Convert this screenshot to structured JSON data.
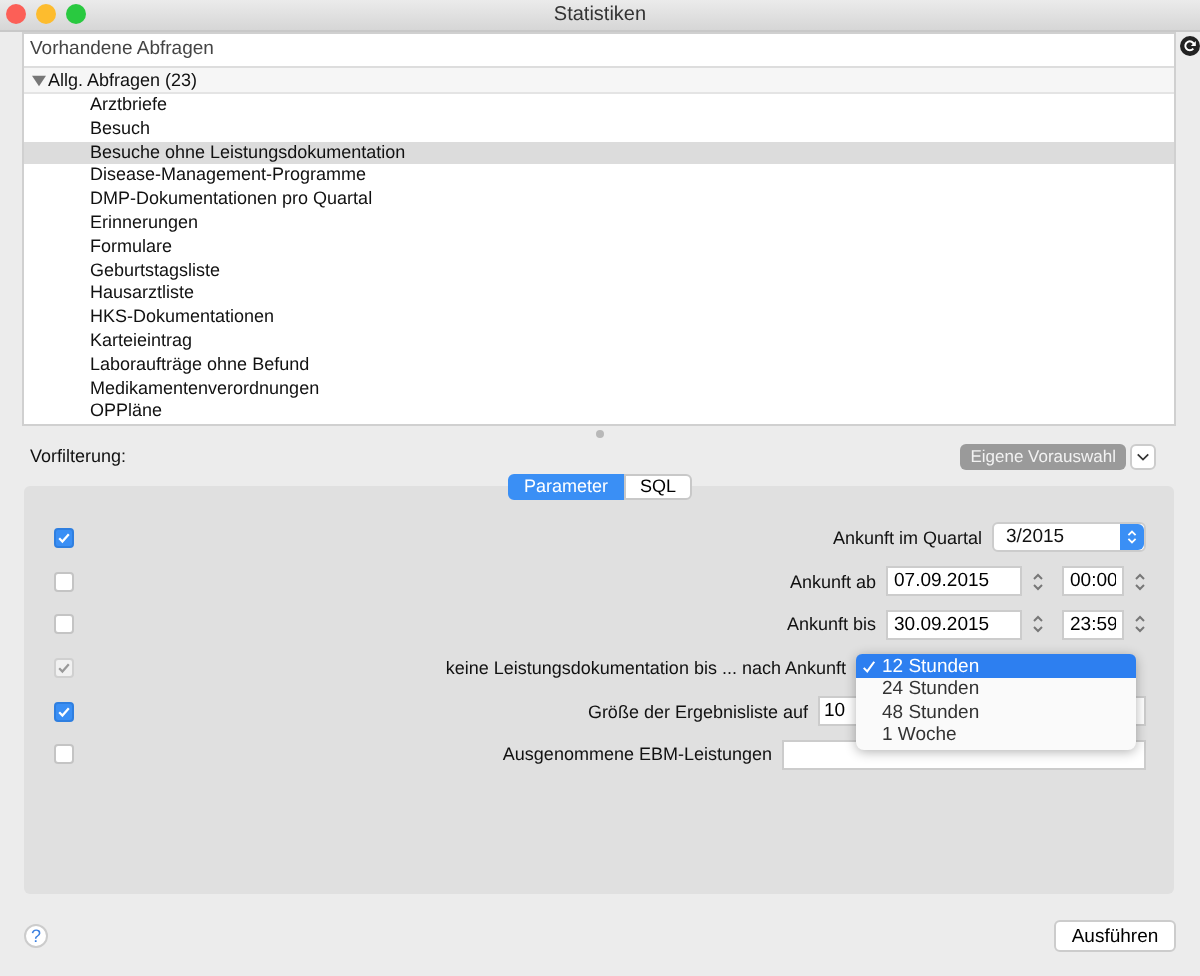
{
  "window": {
    "title": "Statistiken"
  },
  "query_list": {
    "header": "Vorhandene Abfragen",
    "groups": [
      {
        "label": "Allg. Abfragen (23)",
        "expanded": true,
        "children": [
          {
            "label": "Arztbriefe",
            "selected": false
          },
          {
            "label": "Besuch",
            "selected": false
          },
          {
            "label": "Besuche ohne Leistungsdokumentation",
            "selected": true
          },
          {
            "label": "Disease-Management-Programme",
            "selected": false
          },
          {
            "label": "DMP-Dokumentationen pro Quartal",
            "selected": false
          },
          {
            "label": "Erinnerungen",
            "selected": false
          },
          {
            "label": "Formulare",
            "selected": false
          },
          {
            "label": "Geburtstagsliste",
            "selected": false
          },
          {
            "label": "Hausarztliste",
            "selected": false
          },
          {
            "label": "HKS-Dokumentationen",
            "selected": false
          },
          {
            "label": "Karteieintrag",
            "selected": false
          },
          {
            "label": "Laboraufträge ohne Befund",
            "selected": false
          },
          {
            "label": "Medikamentenverordnungen",
            "selected": false
          },
          {
            "label": "OPPläne",
            "selected": false
          }
        ]
      }
    ]
  },
  "prefilter": {
    "label": "Vorfilterung:",
    "preset_button": "Eigene Vorauswahl"
  },
  "tabs": [
    {
      "label": "Parameter",
      "selected": true
    },
    {
      "label": "SQL",
      "selected": false
    }
  ],
  "parameters": [
    {
      "kind": "select",
      "checked": true,
      "disabled": false,
      "label": "Ankunft im Quartal",
      "value": "3/2015"
    },
    {
      "kind": "datetime",
      "checked": false,
      "disabled": false,
      "label": "Ankunft ab",
      "date": "07.09.2015",
      "time": "00:00"
    },
    {
      "kind": "datetime",
      "checked": false,
      "disabled": false,
      "label": "Ankunft bis",
      "date": "30.09.2015",
      "time": "23:59"
    },
    {
      "kind": "menu",
      "checked": true,
      "disabled": true,
      "label": "keine Leistungsdokumentation bis ... nach Ankunft",
      "open": true,
      "options": [
        {
          "label": "12 Stunden",
          "selected": true
        },
        {
          "label": "24 Stunden",
          "selected": false
        },
        {
          "label": "48 Stunden",
          "selected": false
        },
        {
          "label": "1 Woche",
          "selected": false
        }
      ]
    },
    {
      "kind": "number",
      "checked": true,
      "disabled": false,
      "label": "Größe der Ergebnisliste auf",
      "value": "10"
    },
    {
      "kind": "text",
      "checked": false,
      "disabled": false,
      "label": "Ausgenommene EBM-Leistungen"
    }
  ],
  "buttons": {
    "help": "?",
    "run": "Ausführen"
  }
}
